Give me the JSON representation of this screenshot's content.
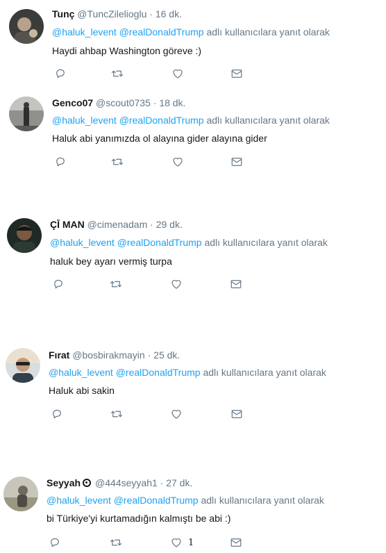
{
  "tweets": [
    {
      "name": "Tunç",
      "handle": "@TuncZilelioglu",
      "time": "16 dk.",
      "mentions": [
        "@haluk_levent",
        "@realDonaldTrump"
      ],
      "reply_suffix": "adlı kullanıcılara yanıt olarak",
      "text": "Haydi ahbap Washington göreve :)"
    },
    {
      "name": "Genco07",
      "handle": "@scout0735",
      "time": "18 dk.",
      "mentions": [
        "@haluk_levent",
        "@realDonaldTrump"
      ],
      "reply_suffix": "adlı kullanıcılara yanıt olarak",
      "text": "Haluk abi yanımızda ol alayına gider alayına gider"
    },
    {
      "name": "ÇĪ MAN",
      "handle": "@cimenadam",
      "time": "29 dk.",
      "mentions": [
        "@haluk_levent",
        "@realDonaldTrump"
      ],
      "reply_suffix": "adlı kullanıcılara yanıt olarak",
      "text": "haluk bey ayarı vermiş turpa"
    },
    {
      "name": "Fırat",
      "handle": "@bosbirakmayin",
      "time": "25 dk.",
      "mentions": [
        "@haluk_levent",
        "@realDonaldTrump"
      ],
      "reply_suffix": "adlı kullanıcılara yanıt olarak",
      "text": "Haluk abi sakin"
    },
    {
      "name": "Seyyah",
      "handle": "@444seyyah1",
      "time": "27 dk.",
      "mentions": [
        "@haluk_levent",
        "@realDonaldTrump"
      ],
      "reply_suffix": "adlı kullanıcılara yanıt olarak",
      "text": "bi Türkiye'yi kurtamadığın kalmıştı be abi :)",
      "like_count": "1"
    }
  ],
  "separator": "·",
  "icons": {
    "reply": "reply-icon",
    "retweet": "retweet-icon",
    "like": "heart-icon",
    "dm": "envelope-icon",
    "verified": "verified-badge-icon"
  },
  "colors": {
    "link": "#1da1f2",
    "muted": "#657786",
    "text": "#14171a"
  }
}
